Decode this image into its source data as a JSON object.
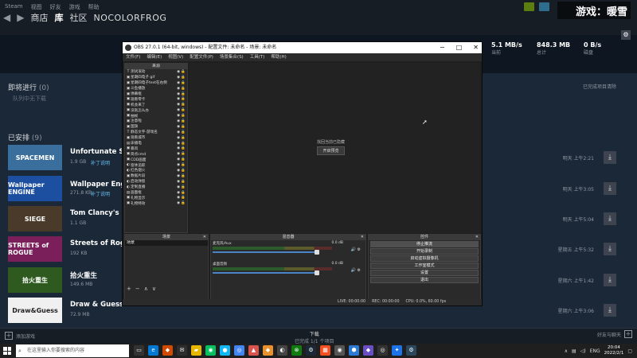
{
  "steam": {
    "menu": [
      "Steam",
      "视图",
      "好友",
      "游戏",
      "帮助"
    ],
    "nav": {
      "store": "商店",
      "library": "库",
      "community": "社区",
      "user": "NOCOLORFROG"
    },
    "watermark": "游戏：暖雪",
    "stats": [
      {
        "value": "5.1 MB/s",
        "label": "当前"
      },
      {
        "value": "848.3 MB",
        "label": "总计"
      },
      {
        "value": "0 B/s",
        "label": "磁盘"
      }
    ],
    "queue": {
      "title": "即将进行",
      "count": "(0)",
      "empty": "队列中无下载",
      "clear": "已完成项目清除"
    },
    "scheduled": {
      "title": "已安排",
      "count": "(9)"
    },
    "games": [
      {
        "name": "Unfortunate Spacemen",
        "thumb": "SPACEMEN",
        "size": "1.9 GB",
        "patch": "补丁说明",
        "time": "明天 上午2:21",
        "color": "#3a6e9c"
      },
      {
        "name": "Wallpaper Engine：壁纸引擎",
        "thumb": "Wallpaper ENGINE",
        "size": "271.8 KB",
        "patch": "补丁说明",
        "time": "明天 上午3:05",
        "color": "#1c4fa0"
      },
      {
        "name": "Tom Clancy's Rainbow Six Siege",
        "thumb": "SIEGE",
        "size": "1.1 GB",
        "patch": "",
        "time": "明天 上午5:04",
        "color": "#4a3a2a"
      },
      {
        "name": "Streets of Rogue",
        "thumb": "STREETS of ROGUE",
        "size": "192 KB",
        "patch": "",
        "time": "星期五 上午5:32",
        "color": "#7a1f5a"
      },
      {
        "name": "拾火重生",
        "thumb": "拾火重生",
        "size": "149.6 MB",
        "patch": "",
        "time": "星期六 上午1:42",
        "color": "#2e5a20"
      },
      {
        "name": "Draw & Guess",
        "thumb": "Draw&Guess",
        "size": "72.9 MB",
        "patch": "",
        "time": "星期六 上午3:06",
        "color": "#f0f0f0"
      }
    ],
    "bottom": {
      "add_game": "添加游戏",
      "dl_title": "下载",
      "dl_sub": "已完成 1/1 个项目",
      "friends": "好友与聊天"
    }
  },
  "obs": {
    "title": "OBS 27.0.1 (64-bit, windows) - 配置文件: 未命名 - 场景: 未命名",
    "menu": [
      "文件(F)",
      "编辑(E)",
      "视图(V)",
      "配置文件(P)",
      "场景集合(S)",
      "工具(T)",
      "帮助(H)"
    ],
    "sources_header": "来源",
    "sources": [
      {
        "icon": "T",
        "name": "测试滚动"
      },
      {
        "icon": "▣",
        "name": "星期四电子 gif"
      },
      {
        "icon": "▣",
        "name": "星期四电子text在右侧"
      },
      {
        "icon": "▣",
        "name": "斗鱼播放"
      },
      {
        "icon": "▣",
        "name": "弹幕框"
      },
      {
        "icon": "▣",
        "name": "观看零卡"
      },
      {
        "icon": "▣",
        "name": "机会来了"
      },
      {
        "icon": "▣",
        "name": "没就怎么办"
      },
      {
        "icon": "▣",
        "name": "抽帧"
      },
      {
        "icon": "▣",
        "name": "注意啦"
      },
      {
        "icon": "▣",
        "name": "国旗"
      },
      {
        "icon": "T",
        "name": "静态文字-游戏名"
      },
      {
        "icon": "▣",
        "name": "观看城市"
      },
      {
        "icon": "▤",
        "name": "床播电"
      },
      {
        "icon": "▣",
        "name": "暴风"
      },
      {
        "icon": "▣",
        "name": "简点cmd"
      },
      {
        "icon": "▣",
        "name": "CDD画面"
      },
      {
        "icon": "◐",
        "name": "窗体追踪"
      },
      {
        "icon": "◐",
        "name": "红色烟火"
      },
      {
        "icon": "▣",
        "name": "数据片段"
      },
      {
        "icon": "◐",
        "name": "启动弹窗"
      },
      {
        "icon": "◐",
        "name": "定制直播"
      },
      {
        "icon": "▤",
        "name": "画面框"
      },
      {
        "icon": "▣",
        "name": "礼物显示"
      },
      {
        "icon": "▣",
        "name": "礼物特效"
      }
    ],
    "preview_msg": "找回当前已隐藏",
    "preview_btn": "开启预览",
    "scenes_header": "场景",
    "scene_item": "场景",
    "mixer_header": "混音器",
    "mixer": [
      {
        "name": "麦克风/Aux",
        "db": "0.0 dB"
      },
      {
        "name": "桌面音频",
        "db": "0.0 dB"
      }
    ],
    "controls_header": "控件",
    "controls": [
      "停止推流",
      "开始录制",
      "启动虚拟摄像机",
      "工作室模式",
      "设置",
      "退出"
    ],
    "status": [
      "LIVE: 00:00:00",
      "REC: 00:00:00",
      "CPU: 0.0%, 60.00 fps"
    ]
  },
  "taskbar": {
    "search_placeholder": "在这里输入你要搜索的内容",
    "tray": [
      "∧",
      "ENG"
    ],
    "time": "20:04",
    "date": "2022/2/1"
  }
}
